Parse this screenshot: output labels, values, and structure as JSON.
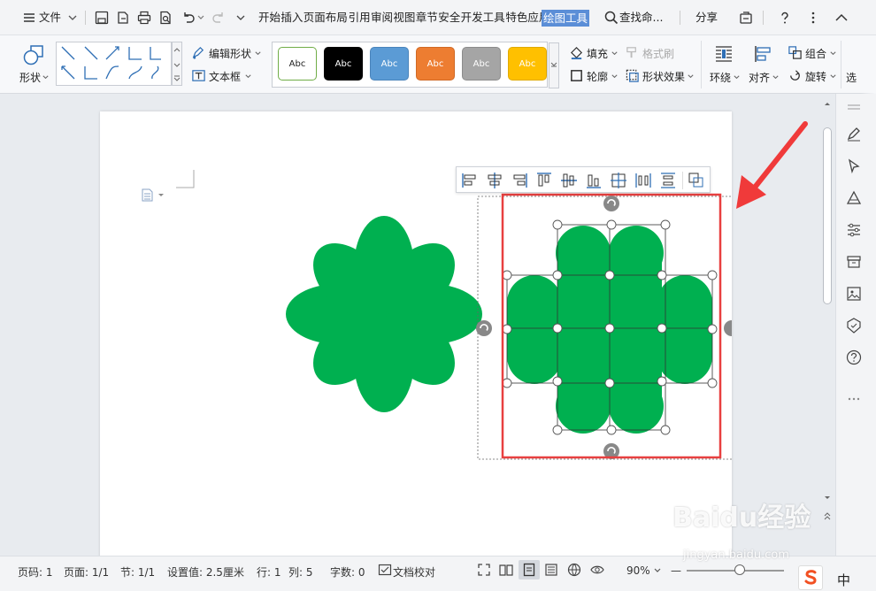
{
  "menubar": {
    "file_label": "文件",
    "tabs": [
      "开始",
      "插入",
      "页面布局",
      "引用",
      "审阅",
      "视图",
      "章节",
      "安全",
      "开发工具",
      "特色应用"
    ],
    "active_tab": "绘图工具",
    "search_label": "查找命...",
    "share_label": "分享"
  },
  "ribbon": {
    "shape_label": "形状",
    "edit_shape_label": "编辑形状",
    "textbox_label": "文本框",
    "style_swatches": [
      {
        "text": "Abc",
        "bg": "#ffffff",
        "fg": "#222222",
        "border": "#70ad47"
      },
      {
        "text": "Abc",
        "bg": "#000000",
        "fg": "#ffffff",
        "border": "#000000"
      },
      {
        "text": "Abc",
        "bg": "#5b9bd5",
        "fg": "#ffffff",
        "border": "#4a84bb"
      },
      {
        "text": "Abc",
        "bg": "#ed7d31",
        "fg": "#ffffff",
        "border": "#d06a25"
      },
      {
        "text": "Abc",
        "bg": "#a5a5a5",
        "fg": "#ffffff",
        "border": "#8c8c8c"
      },
      {
        "text": "Abc",
        "bg": "#ffc000",
        "fg": "#ffffff",
        "border": "#e0aa00"
      }
    ],
    "fill_label": "填充",
    "format_brush_label": "格式刷",
    "outline_label": "轮廓",
    "shape_effect_label": "形状效果",
    "wrap_label": "环绕",
    "align_label": "对齐",
    "group_label": "组合",
    "rotate_label": "旋转",
    "select_label": "选"
  },
  "shapes": {
    "fill_color": "#00b050",
    "selection_color": "#e84040"
  },
  "statusbar": {
    "page_code": "页码: 1",
    "page": "页面: 1/1",
    "section": "节: 1/1",
    "setting": "设置值: 2.5厘米",
    "row": "行: 1",
    "col": "列: 5",
    "word_count": "字数: 0",
    "proofread": "文档校对",
    "zoom": "90%"
  },
  "ime": {
    "lang": "中"
  },
  "watermark": {
    "text": "Baidu经验",
    "sub": "jingyan.baidu.com"
  }
}
